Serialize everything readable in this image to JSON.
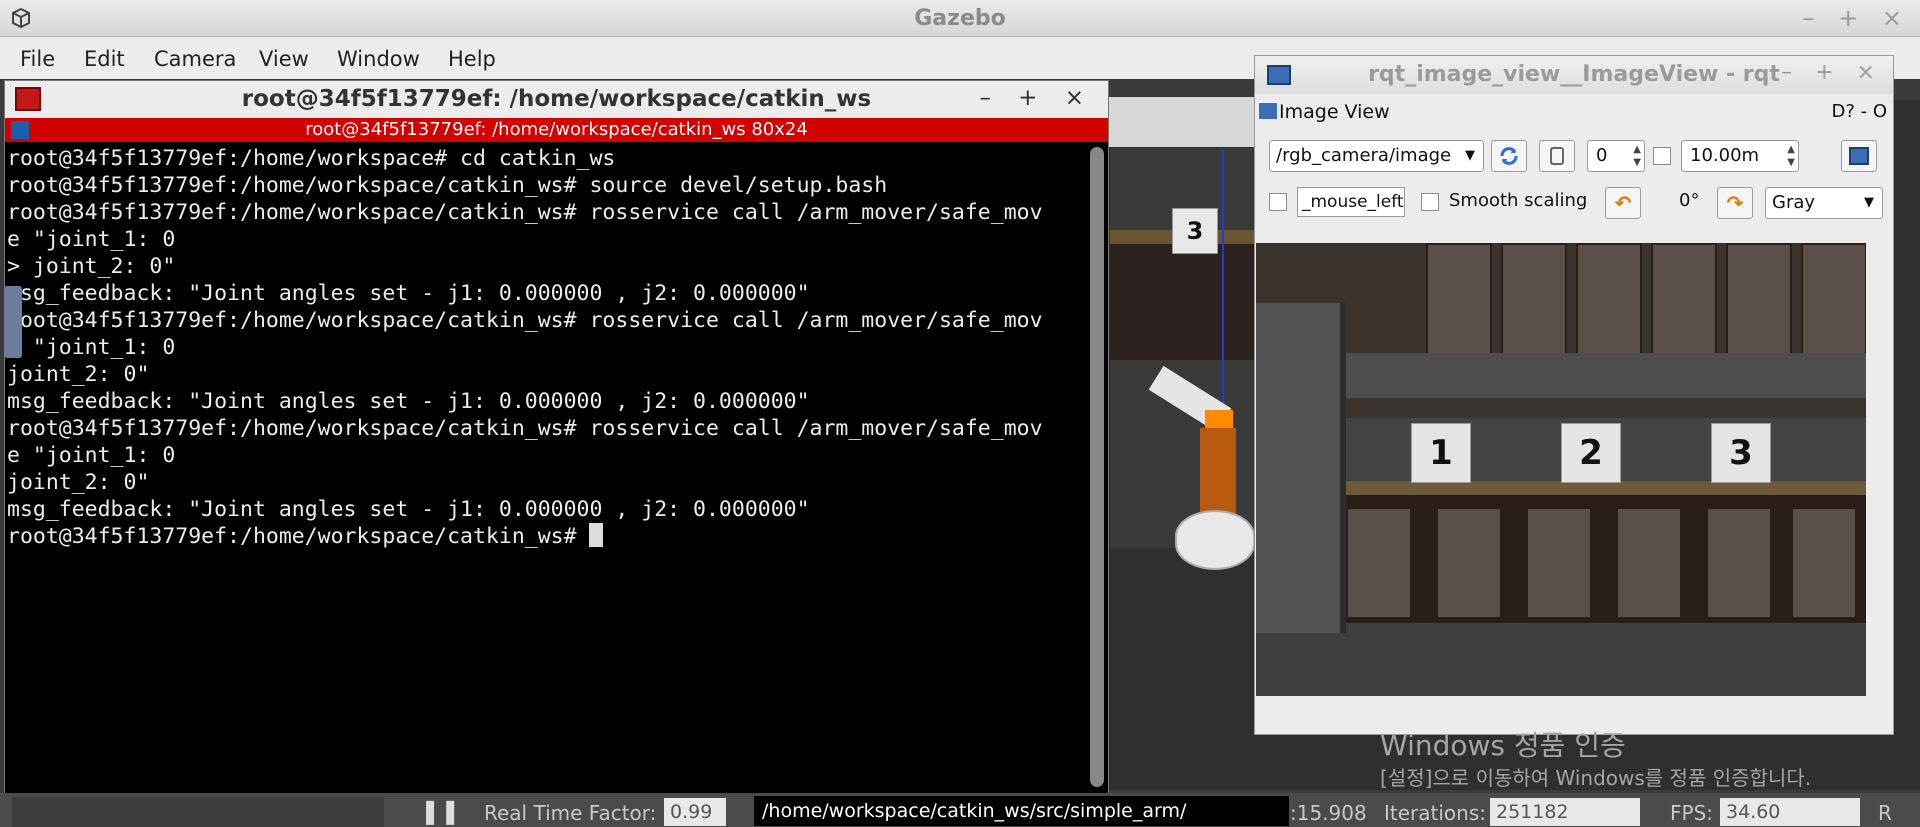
{
  "gazebo": {
    "title": "Gazebo",
    "window_controls": "– + ×",
    "menu": [
      "File",
      "Edit",
      "Camera",
      "View",
      "Window",
      "Help"
    ]
  },
  "terminal": {
    "title": "root@34f5f13779ef: /home/workspace/catkin_ws",
    "window_controls": "– + ×",
    "tab_label": "root@34f5f13779ef: /home/workspace/catkin_ws 80x24",
    "lines": [
      "root@34f5f13779ef:/home/workspace# cd catkin_ws",
      "root@34f5f13779ef:/home/workspace/catkin_ws# source devel/setup.bash",
      "root@34f5f13779ef:/home/workspace/catkin_ws# rosservice call /arm_mover/safe_mov",
      "e \"joint_1: 0",
      "> joint_2: 0\"",
      "msg_feedback: \"Joint angles set - j1: 0.000000 , j2: 0.000000\"",
      "root@34f5f13779ef:/home/workspace/catkin_ws# rosservice call /arm_mover/safe_mov",
      "e \"joint_1: 0",
      "joint_2: 0\"",
      "msg_feedback: \"Joint angles set - j1: 0.000000 , j2: 0.000000\"",
      "root@34f5f13779ef:/home/workspace/catkin_ws# rosservice call /arm_mover/safe_mov",
      "e \"joint_1: 0",
      "joint_2: 0\"",
      "msg_feedback: \"Joint angles set - j1: 0.000000 , j2: 0.000000\""
    ],
    "prompt": "root@34f5f13779ef:/home/workspace/catkin_ws# "
  },
  "rqt": {
    "title": "rqt_image_view__ImageView - rqt",
    "window_controls": "– + ×",
    "plugin_label": "Image View",
    "plugin_controls": "D? - O",
    "topic": "/rgb_camera/image",
    "spin_value": "0",
    "max_range": "10.00m",
    "mouse_topic": "_mouse_left",
    "smooth_label": "Smooth scaling",
    "rotation": "0°",
    "color_scheme": "Gray"
  },
  "scene": {
    "block_label": "3"
  },
  "camera_blocks": [
    "1",
    "2",
    "3"
  ],
  "watermark": {
    "line1": "Windows 정품 인증",
    "line2": "[설정]으로 이동하여 Windows를 정품 인증합니다."
  },
  "status": {
    "rtf_label": "Real Time Factor:",
    "rtf_value": "0.99",
    "path": "/home/workspace/catkin_ws/src/simple_arm/",
    "time_fragment": ":15.908",
    "iterations_label": "Iterations:",
    "iterations_value": "251182",
    "fps_label": "FPS:",
    "fps_value": "34.60",
    "reset_label": "R"
  }
}
